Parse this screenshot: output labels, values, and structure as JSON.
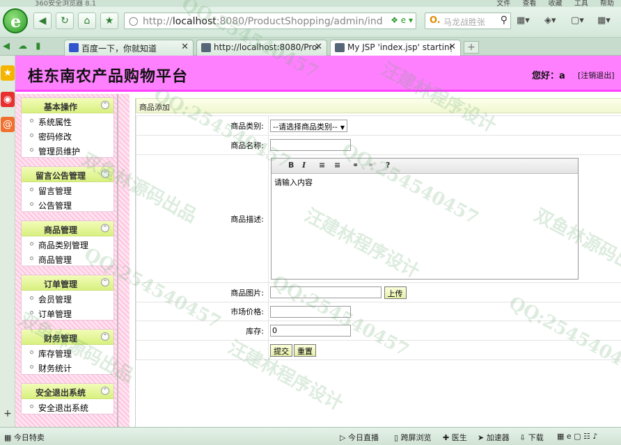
{
  "browser": {
    "title": "360安全浏览器 8.1",
    "menus": [
      "文件",
      "查看",
      "收藏",
      "工具",
      "帮助"
    ],
    "address": {
      "host": "localhost",
      "rest": ":8080/ProductShopping/admin/ind"
    },
    "search_placeholder": "马龙战胜张",
    "tabs": [
      {
        "label": "百度一下，你就知道"
      },
      {
        "label": "http://localhost:8080/Produ"
      },
      {
        "label": "My JSP 'index.jsp' starting p"
      }
    ],
    "status": {
      "left": "今日特卖",
      "items": [
        "今日直播",
        "跨屏浏览",
        "医生",
        "加速器",
        "下载"
      ]
    }
  },
  "site": {
    "title": "桂东南农产品购物平台",
    "greeting": "您好：a",
    "logout": "[注销退出]"
  },
  "sidebar": {
    "groups": [
      {
        "title": "基本操作",
        "items": [
          "系统属性",
          "密码修改",
          "管理员维护"
        ]
      },
      {
        "title": "留言公告管理",
        "items": [
          "留言管理",
          "公告管理"
        ]
      },
      {
        "title": "商品管理",
        "items": [
          "商品类别管理",
          "商品管理"
        ]
      },
      {
        "title": "订单管理",
        "items": [
          "会员管理",
          "订单管理"
        ]
      },
      {
        "title": "财务管理",
        "items": [
          "库存管理",
          "财务统计"
        ]
      },
      {
        "title": "安全退出系统",
        "items": [
          "安全退出系统"
        ]
      }
    ]
  },
  "form": {
    "breadcrumb": "商品添加",
    "category_label": "商品类别:",
    "category_value": "--请选择商品类别--",
    "name_label": "商品名称:",
    "name_value": "",
    "desc_label": "商品描述:",
    "desc_value": "请输入内容",
    "image_label": "商品图片:",
    "upload_label": "上传",
    "price_label": "市场价格:",
    "price_value": "",
    "stock_label": "库存:",
    "stock_value": "0",
    "submit_label": "提交",
    "reset_label": "重置"
  },
  "watermarks": [
    "QQ:254540457",
    "汪建林程序设计",
    "双鱼林源码出品"
  ]
}
